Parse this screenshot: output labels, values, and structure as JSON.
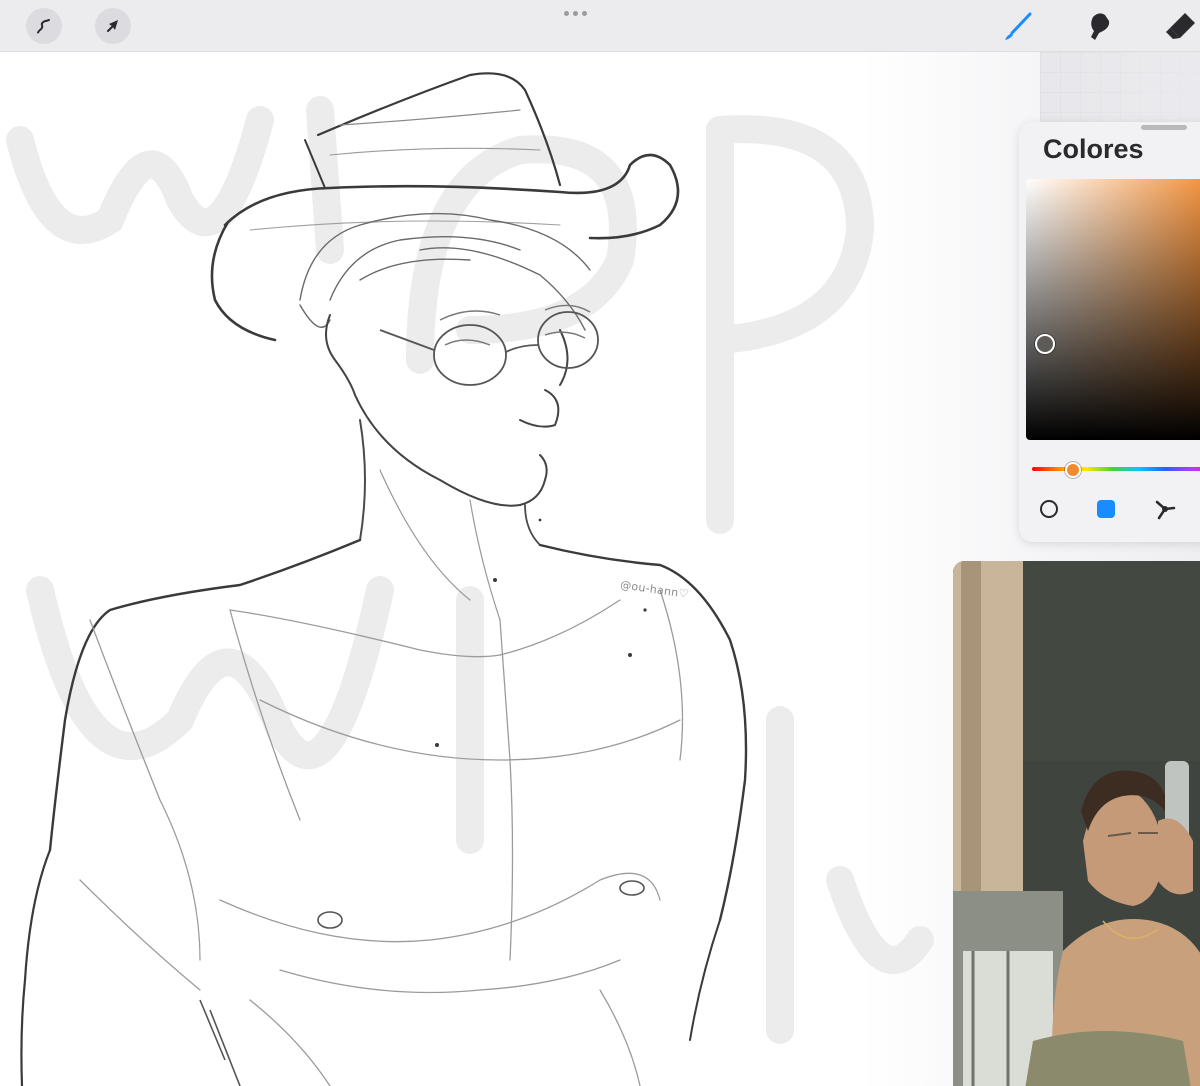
{
  "toolbar": {
    "left_buttons": [
      {
        "name": "adjustments",
        "icon": "magic-wand-icon"
      },
      {
        "name": "selection",
        "icon": "arrow-cursor-icon"
      }
    ],
    "tools": [
      {
        "name": "brush",
        "icon": "brush-icon",
        "active": true,
        "color": "#1a8cff"
      },
      {
        "name": "smudge",
        "icon": "smudge-icon",
        "active": false,
        "color": "#2a2a2e"
      },
      {
        "name": "eraser",
        "icon": "eraser-icon",
        "active": false,
        "color": "#2a2a2e"
      }
    ]
  },
  "canvas": {
    "signature": "@ou-hann♡"
  },
  "colors_panel": {
    "title": "Colores",
    "current_color": "#5d5a57",
    "hue_color": "#f28a2e",
    "modes": [
      {
        "name": "disc",
        "icon": "disc-mode-icon"
      },
      {
        "name": "classic",
        "icon": "classic-mode-icon",
        "active": true
      },
      {
        "name": "harmony",
        "icon": "harmony-mode-icon"
      }
    ]
  },
  "reference": {
    "label": "reference-photo"
  },
  "colors": {
    "accent": "#1a8cff",
    "toolbar_bg": "#ececee",
    "panel_bg": "#f2f2f4"
  }
}
